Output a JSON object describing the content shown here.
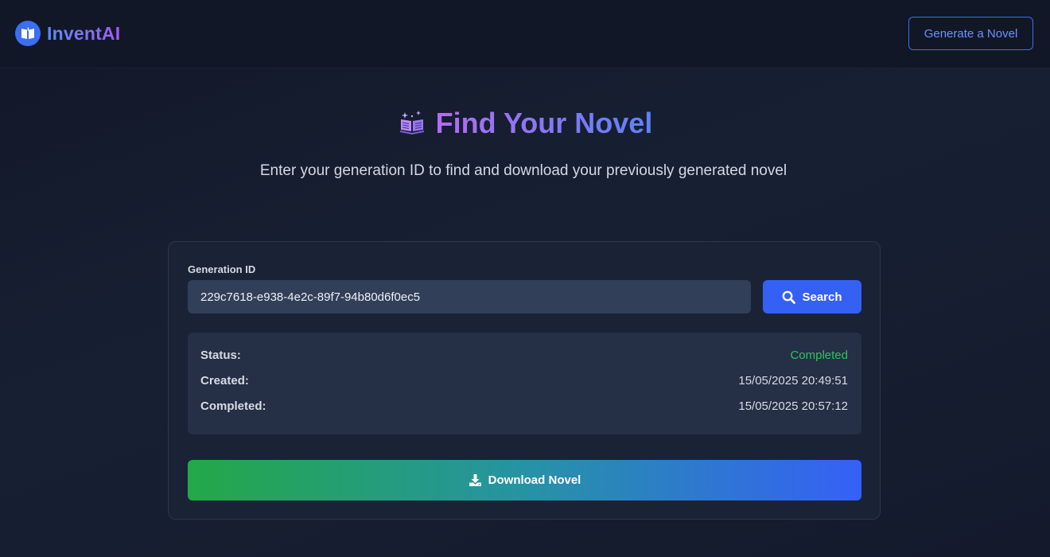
{
  "header": {
    "brand": "InventAI",
    "generate_button": "Generate a Novel"
  },
  "hero": {
    "title": "Find Your Novel",
    "subtitle": "Enter your generation ID to find and download your previously generated novel"
  },
  "search": {
    "label": "Generation ID",
    "value": "229c7618-e938-4e2c-89f7-94b80d6f0ec5",
    "button": "Search"
  },
  "result": {
    "rows": [
      {
        "key": "Status:",
        "value": "Completed"
      },
      {
        "key": "Created:",
        "value": "15/05/2025 20:49:51"
      },
      {
        "key": "Completed:",
        "value": "15/05/2025 20:57:12"
      }
    ],
    "download_button": "Download Novel"
  },
  "icons": {
    "logo": "open-book-icon",
    "hero": "magic-book-emoji",
    "search": "search-icon",
    "download": "download-icon"
  },
  "colors": {
    "primary": "#3560f4",
    "success": "#2fc25b",
    "background": "#141a2c"
  }
}
